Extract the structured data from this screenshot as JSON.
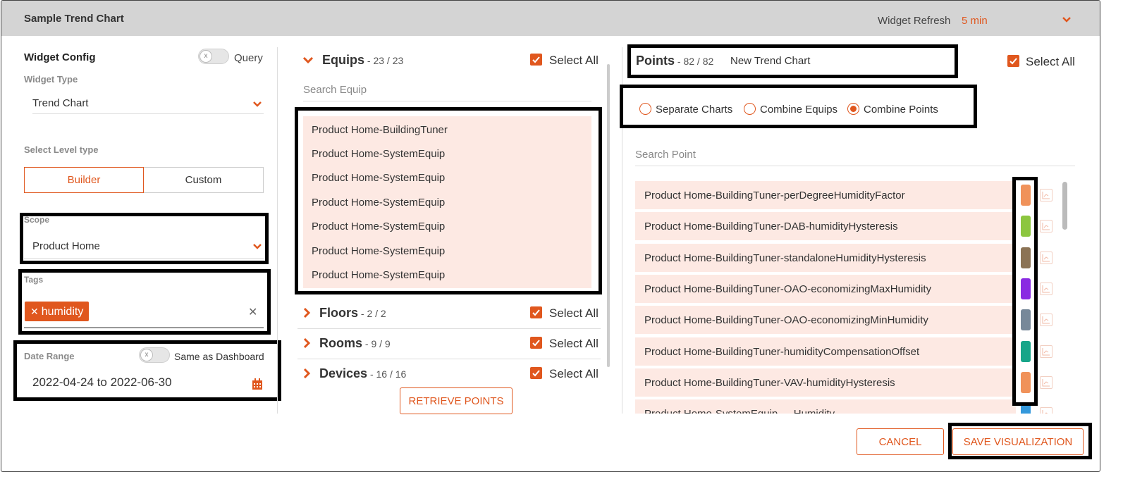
{
  "header": {
    "title": "Sample Trend Chart",
    "refresh_label": "Widget Refresh",
    "refresh_value": "5 min"
  },
  "config": {
    "title": "Widget Config",
    "query_label": "Query",
    "widget_type_label": "Widget Type",
    "widget_type_value": "Trend Chart",
    "level_type_label": "Select Level type",
    "builder_label": "Builder",
    "custom_label": "Custom",
    "scope_label": "Scope",
    "scope_value": "Product Home",
    "tags_label": "Tags",
    "tag_value": "humidity",
    "date_range_label": "Date Range",
    "same_as_dashboard_label": "Same as Dashboard",
    "date_range_value": "2022-04-24 to 2022-06-30"
  },
  "equips": {
    "title": "Equips",
    "count": " - 23 / 23",
    "select_all": "Select All",
    "search_placeholder": "Search Equip",
    "items": [
      "Product Home-BuildingTuner",
      "Product Home-SystemEquip",
      "Product Home-SystemEquip",
      "Product Home-SystemEquip",
      "Product Home-SystemEquip",
      "Product Home-SystemEquip",
      "Product Home-SystemEquip"
    ]
  },
  "floors": {
    "title": "Floors",
    "count": " - 2 / 2",
    "select_all": "Select All"
  },
  "rooms": {
    "title": "Rooms",
    "count": " - 9 / 9",
    "select_all": "Select All"
  },
  "devices": {
    "title": "Devices",
    "count": " - 16 / 16",
    "select_all": "Select All"
  },
  "retrieve_label": "RETRIEVE POINTS",
  "points": {
    "title": "Points",
    "count": " - 82 / 82",
    "chart_name": "New Trend Chart",
    "select_all": "Select All",
    "options": [
      "Separate Charts",
      "Combine Equips",
      "Combine Points"
    ],
    "selected_option": "Combine Points",
    "search_placeholder": "Search Point",
    "items": [
      {
        "label": "Product Home-BuildingTuner-perDegreeHumidityFactor",
        "color": "#f0925a"
      },
      {
        "label": "Product Home-BuildingTuner-DAB-humidityHysteresis",
        "color": "#8cc63f"
      },
      {
        "label": "Product Home-BuildingTuner-standaloneHumidityHysteresis",
        "color": "#8b7355"
      },
      {
        "label": "Product Home-BuildingTuner-OAO-economizingMaxHumidity",
        "color": "#8a2be2"
      },
      {
        "label": "Product Home-BuildingTuner-OAO-economizingMinHumidity",
        "color": "#778899"
      },
      {
        "label": "Product Home-BuildingTuner-humidityCompensationOffset",
        "color": "#17a589"
      },
      {
        "label": "Product Home-BuildingTuner-VAV-humidityHysteresis",
        "color": "#f0925a"
      },
      {
        "label": "Product Home-SystemEquip-...-Humidity",
        "color": "#3498db"
      }
    ]
  },
  "footer": {
    "cancel": "CANCEL",
    "save": "SAVE VISUALIZATION"
  }
}
